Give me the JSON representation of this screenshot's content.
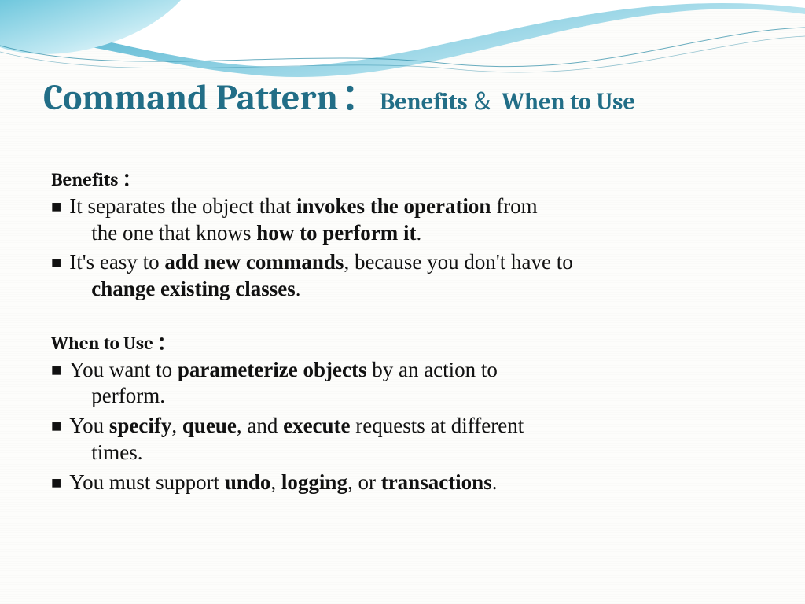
{
  "title": {
    "main": "Command Pattern",
    "colon": "：",
    "sub1": "Benefits",
    "amp": "＆",
    "sub2": "When to Use"
  },
  "benefits": {
    "heading": "Benefits ：",
    "b1": {
      "p1": "It separates the object that ",
      "s1": "invokes the operation",
      "p2": " from",
      "hang1": "the one  that knows ",
      "s2": "how to perform it",
      "p3": "."
    },
    "b2": {
      "p1": "It's easy to ",
      "s1": "add new commands",
      "p2": ", because you don't have to",
      "s2": "change  existing classes",
      "p3": "."
    }
  },
  "when": {
    "heading": "When to Use ：",
    "b1": {
      "p1": "You want to ",
      "s1": "parameterize objects",
      "p2": " by an action to",
      "hang1": "perform."
    },
    "b2": {
      "p1": "You ",
      "s1": "specify",
      "c1": ", ",
      "s2": "queue",
      "c2": ", and ",
      "s3": "execute",
      "p2": " requests   at different",
      "hang1": "times."
    },
    "b3": {
      "p1": "You must support ",
      "s1": "undo",
      "c1": ", ",
      "s2": "logging",
      "c2": ", or ",
      "s3": "transactions",
      "p2": "."
    }
  }
}
